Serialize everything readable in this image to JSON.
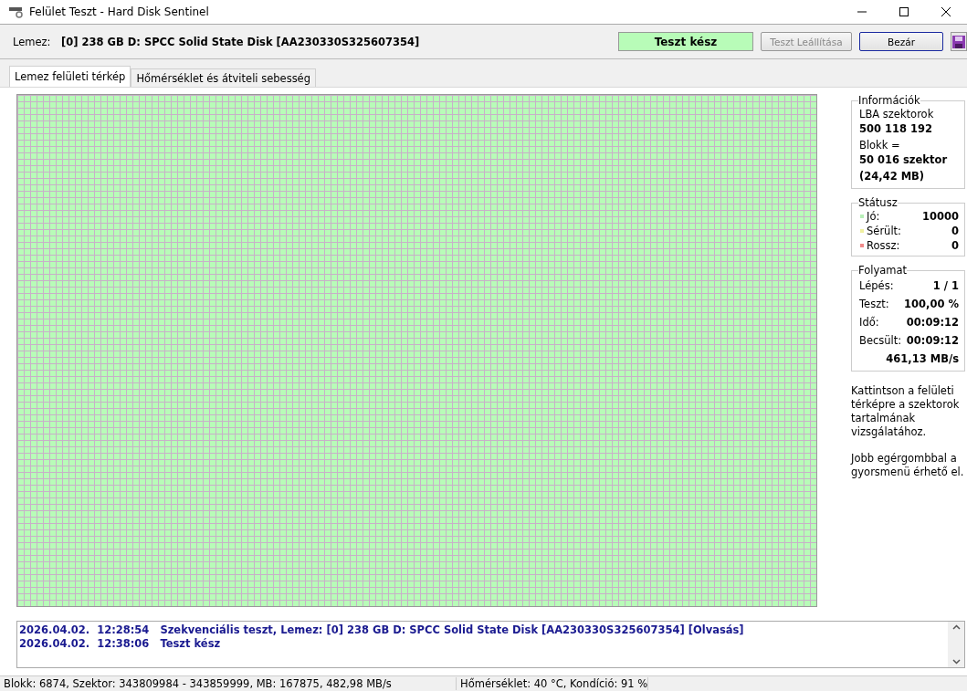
{
  "window": {
    "title": "Felület Teszt - Hard Disk Sentinel"
  },
  "header": {
    "label": "Lemez:",
    "disk": "[0] 238 GB D: SPCC Solid State Disk [AA230330S325607354]",
    "status": "Teszt kész",
    "buttons": [
      {
        "label": "Teszt Leállítása",
        "disabled": true,
        "selected": false
      },
      {
        "label": "Bezár",
        "disabled": false,
        "selected": true
      }
    ]
  },
  "tabs": [
    {
      "label": "Lemez felületi térkép",
      "selected": true
    },
    {
      "label": "Hőmérséklet és átviteli sebesség",
      "selected": false
    }
  ],
  "info": {
    "title": "Információk",
    "lines": [
      {
        "text": "LBA szektorok",
        "bold": false
      },
      {
        "text": "500 118 192",
        "bold": true
      },
      {
        "text": "Blokk =",
        "bold": false
      },
      {
        "text": "50 016 szektor",
        "bold": true
      },
      {
        "text": "(24,42 MB)",
        "bold": true
      }
    ]
  },
  "status": {
    "title": "Státusz",
    "items": [
      {
        "label": "Jó:",
        "value": "10000",
        "color": "#b8f0b8"
      },
      {
        "label": "Sérült:",
        "value": "0",
        "color": "#f0f0a0"
      },
      {
        "label": "Rossz:",
        "value": "0",
        "color": "#f08a8a"
      }
    ]
  },
  "progress": {
    "title": "Folyamat",
    "rows": [
      {
        "label": "Lépés:",
        "value": "1 / 1"
      },
      {
        "label": "Teszt:",
        "value": "100,00 %"
      },
      {
        "label": "Idő:",
        "value": "00:09:12"
      },
      {
        "label": "Becsült:",
        "value": "00:09:12"
      }
    ],
    "speed": "461,13 MB/s"
  },
  "help": [
    "Kattintson a felületi térképre a szektorok tartalmának vizsgálatához.",
    "Jobb egérgombbal a gyorsmenü érhető el."
  ],
  "log": [
    {
      "date": "2026.04.02.",
      "time": "12:28:54",
      "message": "Szekvenciális teszt, Lemez: [0] 238 GB D: SPCC Solid State Disk [AA230330S325607354] [Olvasás]"
    },
    {
      "date": "2026.04.02.",
      "time": "12:38:06",
      "message": "Teszt kész"
    }
  ],
  "status_bar": [
    "Blokk: 6874, Szektor: 343809984 - 343859999, MB: 167875, 482,98 MB/s",
    "Hőmérséklet: 40  °C,  Kondíció: 91 %"
  ]
}
